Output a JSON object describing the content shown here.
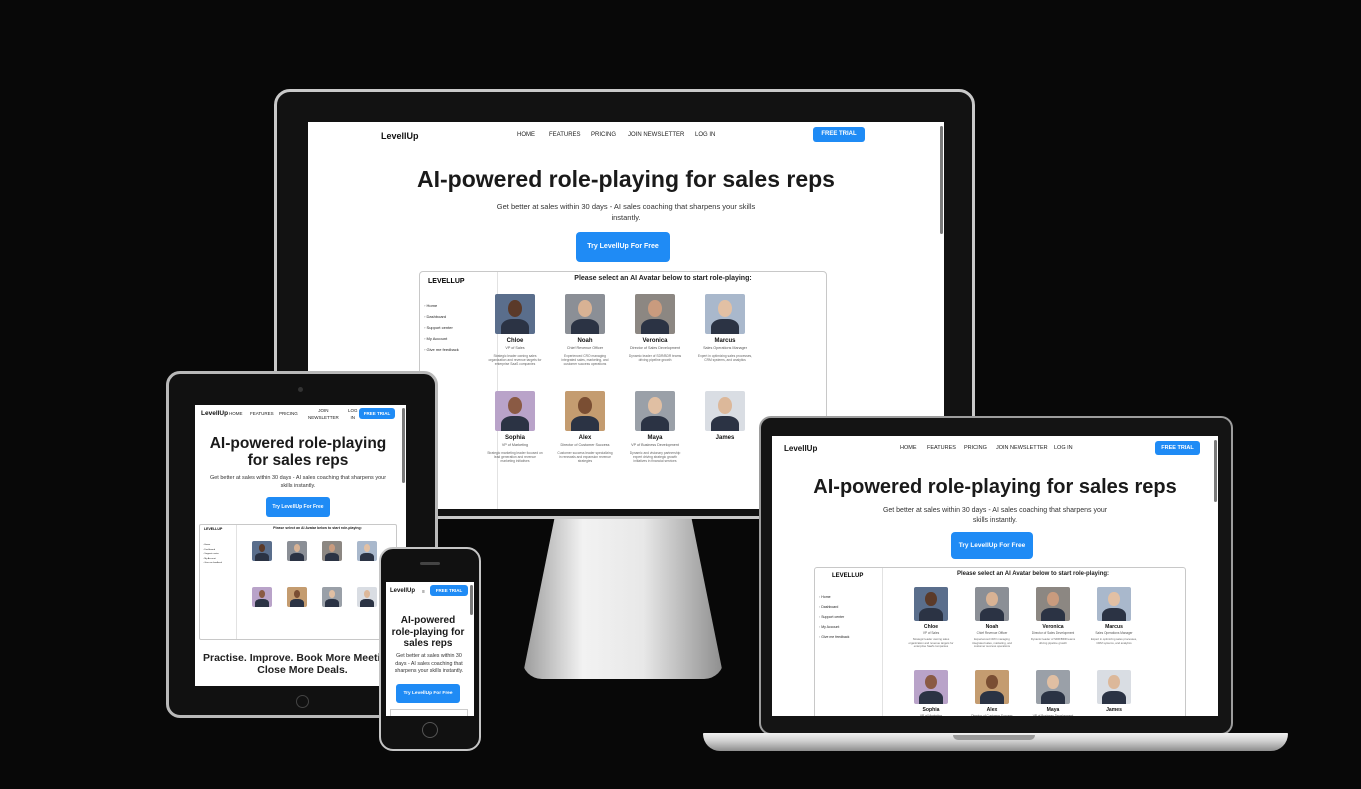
{
  "brand": {
    "logo": "LevellUp",
    "app_logo": "LEVELLUP",
    "accent": "#1f8bf5",
    "background": "#080808"
  },
  "nav": {
    "home": "HOME",
    "features": "FEATURES",
    "pricing": "PRICING",
    "newsletter": "JOIN NEWSLETTER",
    "login": "LOG IN",
    "trial": "FREE TRIAL"
  },
  "tablet_nav": {
    "newsletter_l1": "JOIN",
    "newsletter_l2": "NEWSLETTER",
    "login_l1": "LOG",
    "login_l2": "IN"
  },
  "hero": {
    "title": "AI-powered role-playing for sales reps",
    "title_l1": "AI-powered role-playing",
    "title_l2": "for sales reps",
    "phone_title_l1": "AI-powered",
    "phone_title_l2": "role-playing for",
    "phone_title_l3": "sales reps",
    "subtitle": "Get better at sales within 30 days - AI sales coaching that sharpens your skills instantly.",
    "cta": "Try LevellUp For Free"
  },
  "app": {
    "prompt": "Please select an AI Avatar below to start role-playing:",
    "sidebar": [
      "Home",
      "Dashboard",
      "Support center",
      "My Account",
      "Give me feedback"
    ],
    "sidebar_icons": [
      "home-icon",
      "dashboard-icon",
      "support-icon",
      "account-icon",
      "feedback-icon"
    ]
  },
  "avatars": [
    {
      "name": "Chloe",
      "role": "VP of Sales",
      "desc": "Strategic leader owning sales organization and revenue targets for enterprise SaaS companies",
      "bg": "#5a6e8c",
      "skin": "#5b3a29"
    },
    {
      "name": "Noah",
      "role": "Chief Revenue Officer",
      "desc": "Experienced CRO managing integrated sales, marketing, and customer success operations",
      "bg": "#8b8f96",
      "skin": "#d8b294"
    },
    {
      "name": "Veronica",
      "role": "Director of Sales Development",
      "desc": "Dynamic leader of SDR/BDR teams driving pipeline growth",
      "bg": "#8c8782",
      "skin": "#c99b7e"
    },
    {
      "name": "Marcus",
      "role": "Sales Operations Manager",
      "desc": "Expert in optimizing sales processes, CRM systems, and analytics",
      "bg": "#a9b8cc",
      "skin": "#e2c0a4"
    },
    {
      "name": "Sophia",
      "role": "VP of Marketing",
      "desc": "Strategic marketing leader focused on lead generation and revenue marketing initiatives",
      "bg": "#b9a3c9",
      "skin": "#8a5a44"
    },
    {
      "name": "Alex",
      "role": "Director of Customer Success",
      "desc": "Customer success leader specializing in renewals and expansion revenue strategies",
      "bg": "#c49c70",
      "skin": "#7a4e33"
    },
    {
      "name": "Maya",
      "role": "VP of Business Development",
      "desc": "Dynamic and visionary partnership expert driving strategic growth initiatives in financial services",
      "bg": "#9aa0a8",
      "skin": "#e0bfa3"
    },
    {
      "name": "James",
      "role": "",
      "desc": "",
      "bg": "#d9dde3",
      "skin": "#dcb89a"
    }
  ],
  "tablet_tagline": {
    "l1": "Practise. Improve. Book More Meetings.",
    "l2": "Close More Deals."
  }
}
